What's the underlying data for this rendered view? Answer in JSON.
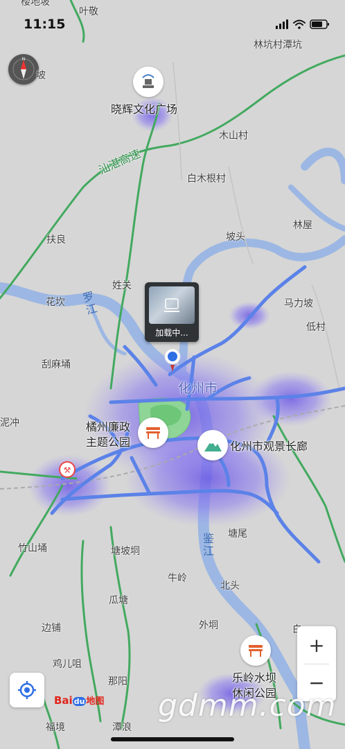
{
  "status_bar": {
    "time": "11:15"
  },
  "places": [
    {
      "id": "yejing",
      "text": "叶敬"
    },
    {
      "id": "lingdibo",
      "text": "楼地坡"
    },
    {
      "id": "linkengcun",
      "text": "林坑村潭坑"
    },
    {
      "id": "po_top",
      "text": "坡"
    },
    {
      "id": "mushancun",
      "text": "木山村"
    },
    {
      "id": "baimugen",
      "text": "白木根村"
    },
    {
      "id": "potou",
      "text": "坡头"
    },
    {
      "id": "linwu",
      "text": "林屋"
    },
    {
      "id": "zhiliang",
      "text": "扶良"
    },
    {
      "id": "xingguan",
      "text": "姓关"
    },
    {
      "id": "huakan",
      "text": "花坎"
    },
    {
      "id": "malipo",
      "text": "马力坡"
    },
    {
      "id": "dicun",
      "text": "低村"
    },
    {
      "id": "guamapeng",
      "text": "刮麻埇"
    },
    {
      "id": "nichong",
      "text": "泥冲"
    },
    {
      "id": "zhushanpeng",
      "text": "竹山埇"
    },
    {
      "id": "tangpodong",
      "text": "塘坡垌"
    },
    {
      "id": "tangwei",
      "text": "塘尾"
    },
    {
      "id": "niuling",
      "text": "牛岭"
    },
    {
      "id": "beitou",
      "text": "北头"
    },
    {
      "id": "guatang",
      "text": "瓜塘"
    },
    {
      "id": "waidong",
      "text": "外垌"
    },
    {
      "id": "bianpu",
      "text": "边铺"
    },
    {
      "id": "jierjiu",
      "text": "鸡儿咀"
    },
    {
      "id": "nalun",
      "text": "那阳"
    },
    {
      "id": "fujing",
      "text": "福境"
    },
    {
      "id": "tanlang",
      "text": "潭浪"
    },
    {
      "id": "bai_right",
      "text": "白"
    },
    {
      "id": "huazhoushi_city",
      "text": "化州市"
    }
  ],
  "highway_label": "汕湛高速",
  "rivers": [
    {
      "id": "luojiang",
      "text": "罗江"
    },
    {
      "id": "jianjiang",
      "text": "鉴江"
    }
  ],
  "pois": [
    {
      "id": "xiaohui",
      "label": "晓辉文化广场",
      "icon": "monument-icon"
    },
    {
      "id": "juzhou",
      "label_line1": "橘州廉政",
      "label_line2": "主题公园",
      "icon": "park-bench-icon"
    },
    {
      "id": "guanjing",
      "label": "化州市观景长廊",
      "icon": "mountain-icon"
    },
    {
      "id": "leling",
      "label_line1": "乐岭水坝",
      "label_line2": "休闲公园",
      "icon": "park-bench-icon"
    }
  ],
  "loading_card": {
    "text": "加载中..."
  },
  "zoom": {
    "in": "+",
    "out": "−"
  },
  "logo": {
    "bai": "Bai",
    "du": "du",
    "map": "地图"
  },
  "watermark": "gdmm.com",
  "colors": {
    "land": "#d8d8d8",
    "water": "#8faee0",
    "major_road": "#5b82e8",
    "highway": "#3fae5f",
    "heat": "#7f6fe8"
  }
}
